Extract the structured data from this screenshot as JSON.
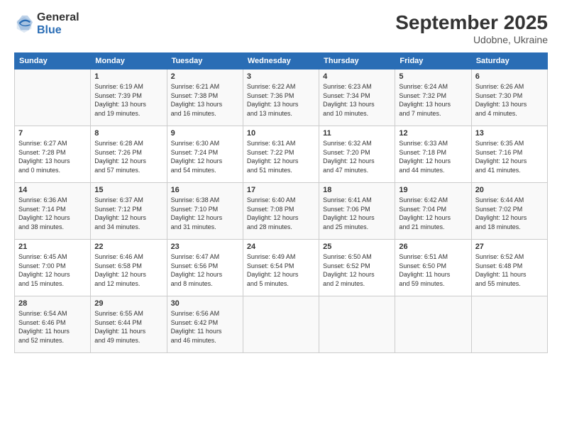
{
  "logo": {
    "general": "General",
    "blue": "Blue"
  },
  "header": {
    "month": "September 2025",
    "location": "Udobne, Ukraine"
  },
  "days_of_week": [
    "Sunday",
    "Monday",
    "Tuesday",
    "Wednesday",
    "Thursday",
    "Friday",
    "Saturday"
  ],
  "weeks": [
    [
      {
        "day": "",
        "content": ""
      },
      {
        "day": "1",
        "content": "Sunrise: 6:19 AM\nSunset: 7:39 PM\nDaylight: 13 hours\nand 19 minutes."
      },
      {
        "day": "2",
        "content": "Sunrise: 6:21 AM\nSunset: 7:38 PM\nDaylight: 13 hours\nand 16 minutes."
      },
      {
        "day": "3",
        "content": "Sunrise: 6:22 AM\nSunset: 7:36 PM\nDaylight: 13 hours\nand 13 minutes."
      },
      {
        "day": "4",
        "content": "Sunrise: 6:23 AM\nSunset: 7:34 PM\nDaylight: 13 hours\nand 10 minutes."
      },
      {
        "day": "5",
        "content": "Sunrise: 6:24 AM\nSunset: 7:32 PM\nDaylight: 13 hours\nand 7 minutes."
      },
      {
        "day": "6",
        "content": "Sunrise: 6:26 AM\nSunset: 7:30 PM\nDaylight: 13 hours\nand 4 minutes."
      }
    ],
    [
      {
        "day": "7",
        "content": "Sunrise: 6:27 AM\nSunset: 7:28 PM\nDaylight: 13 hours\nand 0 minutes."
      },
      {
        "day": "8",
        "content": "Sunrise: 6:28 AM\nSunset: 7:26 PM\nDaylight: 12 hours\nand 57 minutes."
      },
      {
        "day": "9",
        "content": "Sunrise: 6:30 AM\nSunset: 7:24 PM\nDaylight: 12 hours\nand 54 minutes."
      },
      {
        "day": "10",
        "content": "Sunrise: 6:31 AM\nSunset: 7:22 PM\nDaylight: 12 hours\nand 51 minutes."
      },
      {
        "day": "11",
        "content": "Sunrise: 6:32 AM\nSunset: 7:20 PM\nDaylight: 12 hours\nand 47 minutes."
      },
      {
        "day": "12",
        "content": "Sunrise: 6:33 AM\nSunset: 7:18 PM\nDaylight: 12 hours\nand 44 minutes."
      },
      {
        "day": "13",
        "content": "Sunrise: 6:35 AM\nSunset: 7:16 PM\nDaylight: 12 hours\nand 41 minutes."
      }
    ],
    [
      {
        "day": "14",
        "content": "Sunrise: 6:36 AM\nSunset: 7:14 PM\nDaylight: 12 hours\nand 38 minutes."
      },
      {
        "day": "15",
        "content": "Sunrise: 6:37 AM\nSunset: 7:12 PM\nDaylight: 12 hours\nand 34 minutes."
      },
      {
        "day": "16",
        "content": "Sunrise: 6:38 AM\nSunset: 7:10 PM\nDaylight: 12 hours\nand 31 minutes."
      },
      {
        "day": "17",
        "content": "Sunrise: 6:40 AM\nSunset: 7:08 PM\nDaylight: 12 hours\nand 28 minutes."
      },
      {
        "day": "18",
        "content": "Sunrise: 6:41 AM\nSunset: 7:06 PM\nDaylight: 12 hours\nand 25 minutes."
      },
      {
        "day": "19",
        "content": "Sunrise: 6:42 AM\nSunset: 7:04 PM\nDaylight: 12 hours\nand 21 minutes."
      },
      {
        "day": "20",
        "content": "Sunrise: 6:44 AM\nSunset: 7:02 PM\nDaylight: 12 hours\nand 18 minutes."
      }
    ],
    [
      {
        "day": "21",
        "content": "Sunrise: 6:45 AM\nSunset: 7:00 PM\nDaylight: 12 hours\nand 15 minutes."
      },
      {
        "day": "22",
        "content": "Sunrise: 6:46 AM\nSunset: 6:58 PM\nDaylight: 12 hours\nand 12 minutes."
      },
      {
        "day": "23",
        "content": "Sunrise: 6:47 AM\nSunset: 6:56 PM\nDaylight: 12 hours\nand 8 minutes."
      },
      {
        "day": "24",
        "content": "Sunrise: 6:49 AM\nSunset: 6:54 PM\nDaylight: 12 hours\nand 5 minutes."
      },
      {
        "day": "25",
        "content": "Sunrise: 6:50 AM\nSunset: 6:52 PM\nDaylight: 12 hours\nand 2 minutes."
      },
      {
        "day": "26",
        "content": "Sunrise: 6:51 AM\nSunset: 6:50 PM\nDaylight: 11 hours\nand 59 minutes."
      },
      {
        "day": "27",
        "content": "Sunrise: 6:52 AM\nSunset: 6:48 PM\nDaylight: 11 hours\nand 55 minutes."
      }
    ],
    [
      {
        "day": "28",
        "content": "Sunrise: 6:54 AM\nSunset: 6:46 PM\nDaylight: 11 hours\nand 52 minutes."
      },
      {
        "day": "29",
        "content": "Sunrise: 6:55 AM\nSunset: 6:44 PM\nDaylight: 11 hours\nand 49 minutes."
      },
      {
        "day": "30",
        "content": "Sunrise: 6:56 AM\nSunset: 6:42 PM\nDaylight: 11 hours\nand 46 minutes."
      },
      {
        "day": "",
        "content": ""
      },
      {
        "day": "",
        "content": ""
      },
      {
        "day": "",
        "content": ""
      },
      {
        "day": "",
        "content": ""
      }
    ]
  ]
}
